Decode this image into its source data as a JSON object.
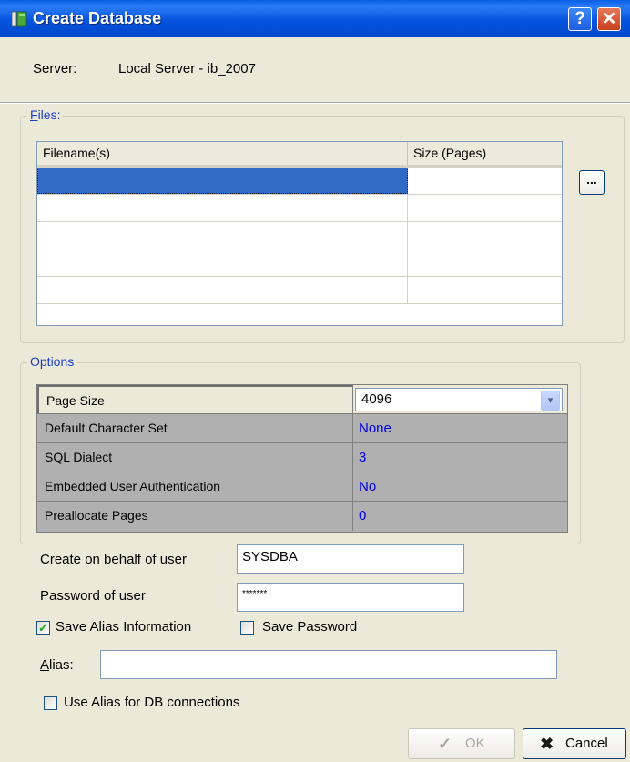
{
  "window": {
    "title": "Create Database",
    "help_glyph": "?",
    "close_glyph": "✕"
  },
  "server": {
    "label": "Server:",
    "value": "Local Server - ib_2007"
  },
  "files": {
    "legend": "Files:",
    "columns": [
      "Filename(s)",
      "Size (Pages)"
    ],
    "rows": [
      {
        "filename": "",
        "size": ""
      },
      {
        "filename": "",
        "size": ""
      },
      {
        "filename": "",
        "size": ""
      },
      {
        "filename": "",
        "size": ""
      },
      {
        "filename": "",
        "size": ""
      }
    ],
    "browse_label": "..."
  },
  "options": {
    "legend": "Options",
    "rows": [
      {
        "label": "Page Size",
        "value": "4096"
      },
      {
        "label": "Default Character Set",
        "value": "None"
      },
      {
        "label": "SQL Dialect",
        "value": "3"
      },
      {
        "label": "Embedded User Authentication",
        "value": "No"
      },
      {
        "label": "Preallocate Pages",
        "value": "0"
      }
    ],
    "dropdown_glyph": "▾"
  },
  "user": {
    "behalf_label": "Create on behalf of user",
    "behalf_value": "SYSDBA",
    "password_label": "Password of user",
    "password_value": "*******"
  },
  "checks": {
    "save_alias": {
      "label": "Save Alias Information",
      "checked": true
    },
    "save_password": {
      "label": "Save Password",
      "checked": false
    },
    "use_alias": {
      "label": "Use Alias for DB connections",
      "checked": false
    }
  },
  "alias": {
    "label": "Alias:",
    "value": ""
  },
  "buttons": {
    "ok_label": "OK",
    "ok_icon": "✓",
    "cancel_label": "Cancel",
    "cancel_icon": "✖"
  },
  "colors": {
    "titlebar": "#0554e0",
    "legend": "#1b3ec8",
    "selection": "#316ac5",
    "option_value": "#0000e0",
    "cancel_icon": "#1a1a1a"
  }
}
